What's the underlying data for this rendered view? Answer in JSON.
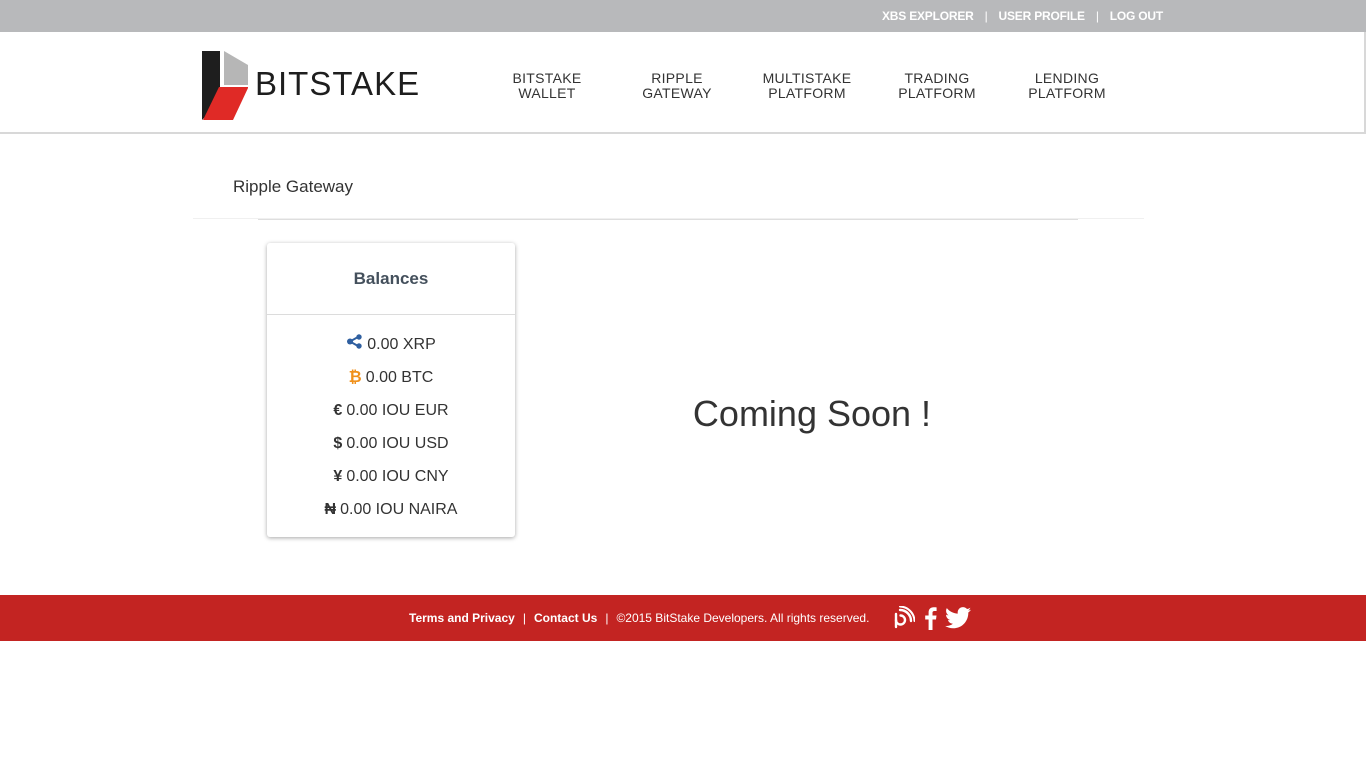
{
  "topbar": {
    "links": [
      "XBS EXPLORER",
      "USER PROFILE",
      "LOG OUT"
    ],
    "separator": "|"
  },
  "brand": {
    "name": "BITSTAKE",
    "colors": {
      "dark": "#1e1e1e",
      "gray": "#b6b6b6",
      "red": "#e02a26"
    }
  },
  "nav": [
    {
      "line1": "BITSTAKE",
      "line2": "WALLET"
    },
    {
      "line1": "RIPPLE",
      "line2": "GATEWAY"
    },
    {
      "line1": "MULTISTAKE",
      "line2": "PLATFORM"
    },
    {
      "line1": "TRADING",
      "line2": "PLATFORM"
    },
    {
      "line1": "LENDING",
      "line2": "PLATFORM"
    }
  ],
  "page": {
    "title": "Ripple Gateway",
    "coming_soon": "Coming Soon !"
  },
  "balances": {
    "title": "Balances",
    "items": [
      {
        "icon": "ripple-icon",
        "symbol": "",
        "text": "0.00 XRP"
      },
      {
        "icon": "bitcoin-icon",
        "symbol": "₿",
        "text": "0.00 BTC"
      },
      {
        "icon": "euro-icon",
        "symbol": "€",
        "text": "0.00 IOU EUR"
      },
      {
        "icon": "dollar-icon",
        "symbol": "$",
        "text": "0.00 IOU USD"
      },
      {
        "icon": "yuan-icon",
        "symbol": "¥",
        "text": "0.00 IOU CNY"
      },
      {
        "icon": "naira-icon",
        "symbol": "₦",
        "text": "0.00 IOU NAIRA"
      }
    ]
  },
  "footer": {
    "terms": "Terms and Privacy",
    "contact": "Contact Us",
    "separator": "|",
    "copyright": "©2015 BitStake Developers. All rights reserved.",
    "social": [
      "blog-icon",
      "facebook-icon",
      "twitter-icon"
    ],
    "color": "#c32422"
  }
}
